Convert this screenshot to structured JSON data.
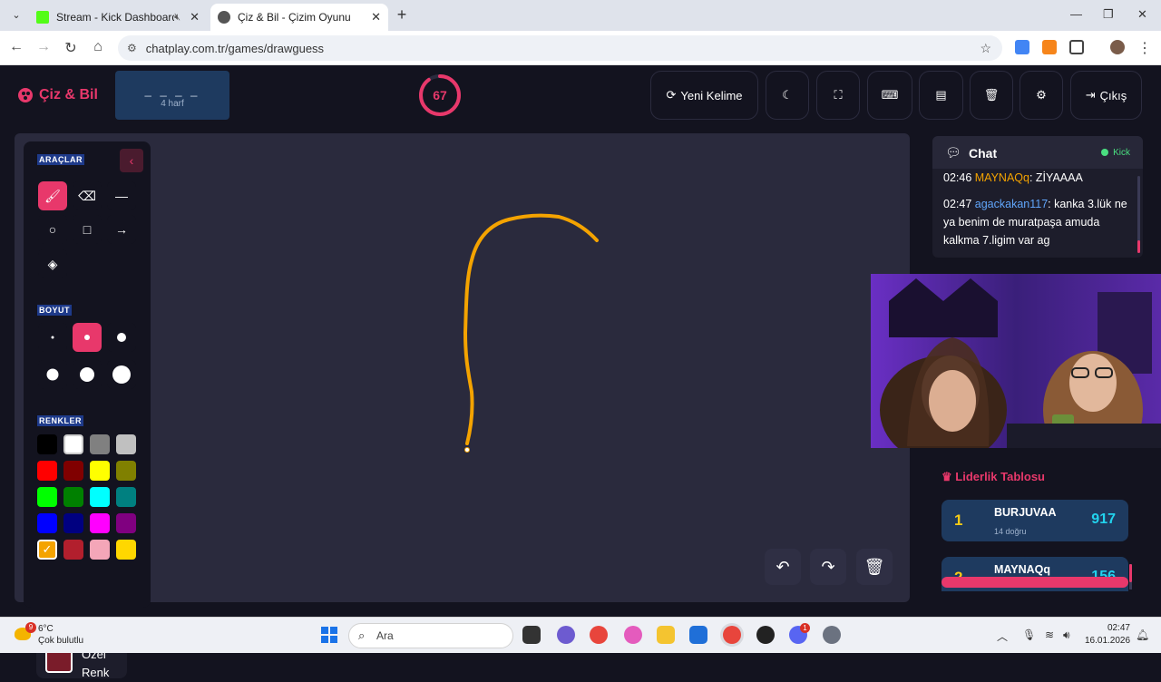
{
  "browser": {
    "tabs": [
      {
        "title": "Stream - Kick Dashboard",
        "fav_color": "#53fc18"
      },
      {
        "title": "Çiz & Bil - Çizim Oyunu",
        "fav_color": "#555555"
      }
    ],
    "url": "chatplay.com.tr/games/drawguess"
  },
  "header": {
    "brand": "Çiz & Bil",
    "word_blanks": "_ _ _ _",
    "word_letters": "4 harf",
    "timer": "67",
    "timer_fraction": 0.9,
    "new_word": "Yeni Kelime",
    "exit": "Çıkış"
  },
  "tools": {
    "section_tools": "ARAÇLAR",
    "section_size": "BOYUT",
    "section_colors": "RENKLER",
    "custom_color": "Özel Renk",
    "custom_color_value": "#7a1c2a",
    "selected_tool": "brush",
    "selected_size": 2,
    "swatches": [
      "#000000",
      "#ffffff",
      "#808080",
      "#c0c0c0",
      "#ff0000",
      "#800000",
      "#ffff00",
      "#808000",
      "#00ff00",
      "#008000",
      "#00ffff",
      "#008080",
      "#0000ff",
      "#000080",
      "#ff00ff",
      "#800080",
      "#f4a300",
      "#b21f2d",
      "#f4a6b8",
      "#ffd700"
    ],
    "selected_swatch": 16
  },
  "accent": "#e8386b",
  "chat": {
    "title": "Chat",
    "status": "Kick",
    "messages": [
      {
        "time": "02:46",
        "user": "MAYNAQq",
        "user_color": "#f4a300",
        "text": "ZİYAAAA"
      },
      {
        "time": "02:47",
        "user": "agackakan117",
        "user_color": "#60a5fa",
        "text": "kanka 3.lük ne ya benim de muratpaşa amuda kalkma 7.ligim var ag"
      }
    ]
  },
  "leaderboard": {
    "title": "Liderlik Tablosu",
    "rows": [
      {
        "rank": "1",
        "name": "BURJUVAA",
        "sub": "14 doğru",
        "score": "917"
      },
      {
        "rank": "2",
        "name": "MAYNAQq",
        "sub": "",
        "score": "156"
      }
    ]
  },
  "taskbar": {
    "weather_badge": "9",
    "temp": "6°C",
    "condition": "Çok bulutlu",
    "search": "Ara",
    "time": "02:47",
    "date": "16.01.2026",
    "discord_badge": "1"
  }
}
